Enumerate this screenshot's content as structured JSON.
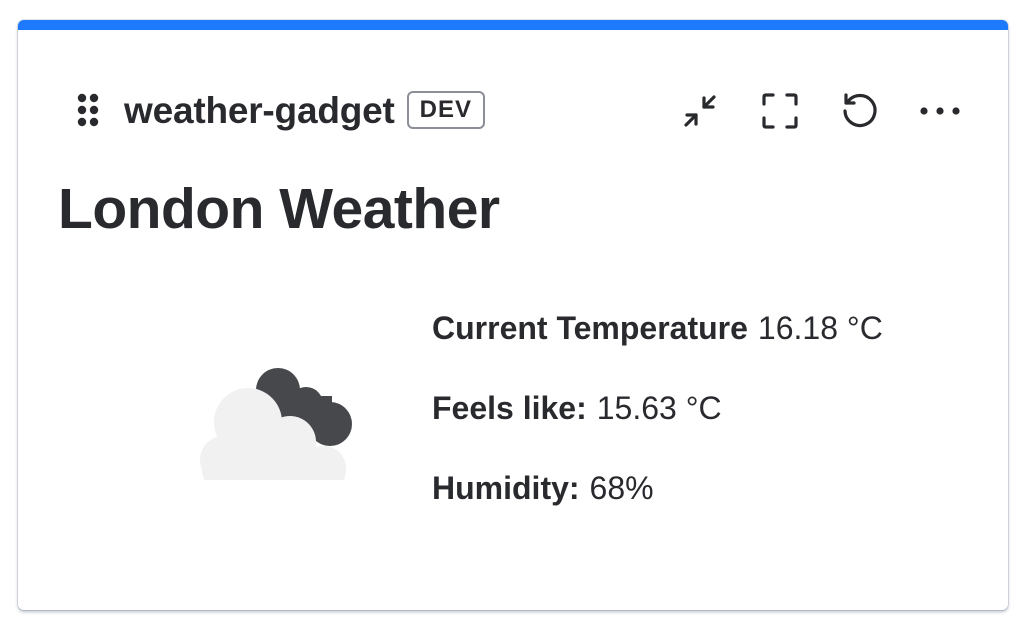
{
  "gadget": {
    "name": "weather-gadget",
    "badge": "DEV",
    "accent_color": "#1d7afc"
  },
  "toolbar": {
    "actions": [
      {
        "icon": "minimize-icon"
      },
      {
        "icon": "fullscreen-icon"
      },
      {
        "icon": "refresh-icon"
      },
      {
        "icon": "more-icon"
      }
    ]
  },
  "weather": {
    "title": "London Weather",
    "icon": "cloud-icon",
    "stats": [
      {
        "label": "Current Temperature",
        "value": "16.18 °C"
      },
      {
        "label": "Feels like:",
        "value": "15.63 °C"
      },
      {
        "label": "Humidity:",
        "value": "68%"
      }
    ]
  }
}
